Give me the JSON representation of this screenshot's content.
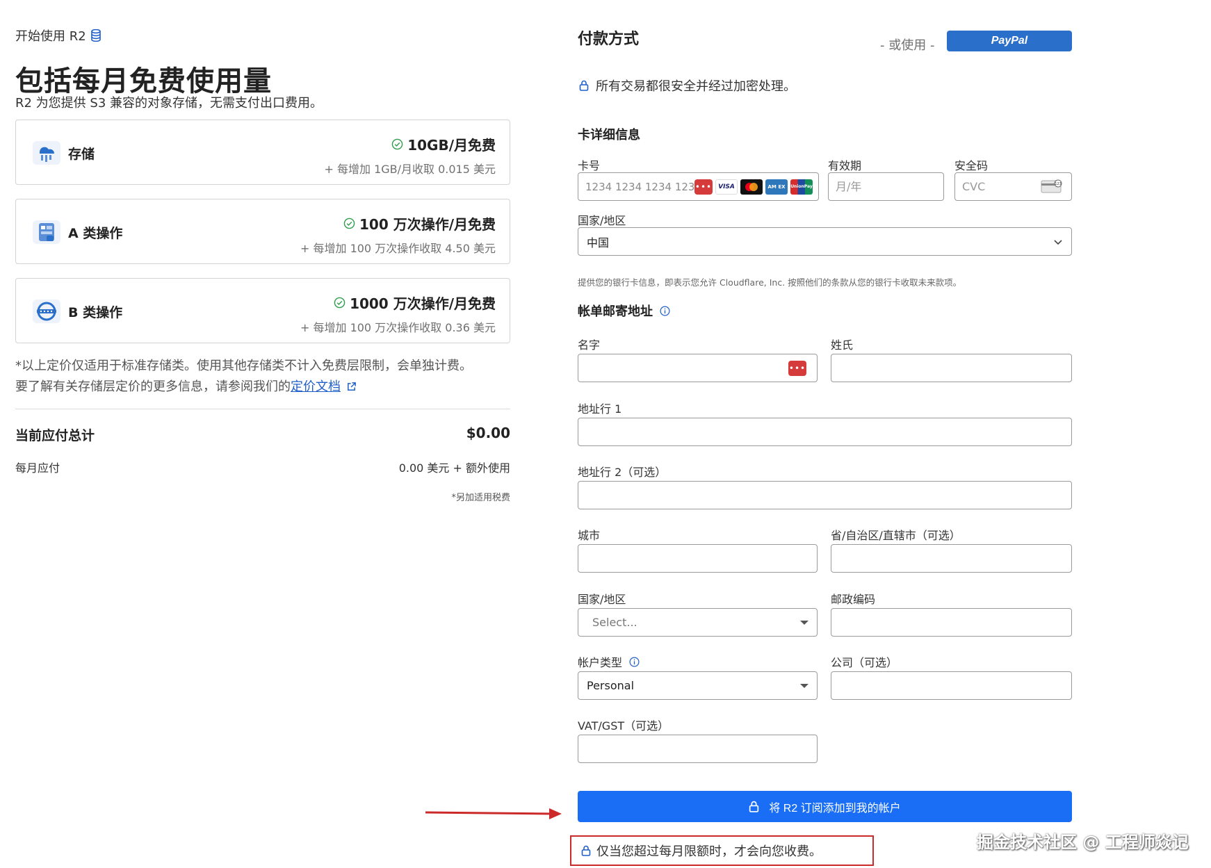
{
  "left": {
    "breadcrumb": "开始使用 R2",
    "title": "包括每月免费使用量",
    "subtitle": "R2 为您提供 S3 兼容的对象存储，无需支付出口费用。",
    "cards": [
      {
        "name": "存储",
        "free": "10GB/月免费",
        "extra": "+ 每增加 1GB/月收取 0.015 美元"
      },
      {
        "name": "A 类操作",
        "free": "100 万次操作/月免费",
        "extra": "+ 每增加 100 万次操作收取 4.50 美元"
      },
      {
        "name": "B 类操作",
        "free": "1000 万次操作/月免费",
        "extra": "+ 每增加 100 万次操作收取 0.36 美元"
      }
    ],
    "note_line1": "*以上定价仅适用于标准存储类。使用其他存储类不计入免费层限制，会单独计费。",
    "note_line2_prefix": "要了解有关存储层定价的更多信息，请参阅我们的",
    "note_link": "定价文档",
    "total_label": "当前应付总计",
    "total_value": "$0.00",
    "monthly_label": "每月应付",
    "monthly_value": "0.00 美元 + 额外使用",
    "tax_note": "*另加适用税费"
  },
  "right": {
    "title": "付款方式",
    "or_use": "- 或使用 -",
    "paypal_label": "PayPal",
    "secure_text": "所有交易都很安全并经过加密处理。",
    "card_section": "卡详细信息",
    "card_number_label": "卡号",
    "card_number_placeholder": "1234 1234 1234 1234",
    "expiry_label": "有效期",
    "expiry_placeholder": "月/年",
    "cvc_label": "安全码",
    "cvc_placeholder": "CVC",
    "country_label": "国家/地区",
    "country_value": "中国",
    "disclaimer": "提供您的银行卡信息，即表示您允许 Cloudflare, Inc. 按照他们的条款从您的银行卡收取未来款项。",
    "billing_section": "帐单邮寄地址",
    "first_name_label": "名字",
    "last_name_label": "姓氏",
    "address1_label": "地址行 1",
    "address2_label": "地址行 2（可选）",
    "city_label": "城市",
    "province_label": "省/自治区/直辖市（可选）",
    "country2_label": "国家/地区",
    "country2_placeholder": "Select...",
    "postal_label": "邮政编码",
    "account_type_label": "帐户类型",
    "account_type_value": "Personal",
    "company_label": "公司（可选）",
    "vat_label": "VAT/GST（可选）",
    "submit_label": "将 R2 订阅添加到我的帐户",
    "bottom_note": "仅当您超过每月限额时，才会向您收费。"
  },
  "brands": {
    "visa": "VISA",
    "amex": "AM EX",
    "unionpay": "UnionPay",
    "keypass": "•••"
  },
  "watermark": "掘金技术社区 @ 工程师焱记",
  "colors": {
    "primary": "#1a6ef5",
    "paypal": "#2a6fc9",
    "highlight": "#cc2a2a",
    "link": "#1f5fc9",
    "success": "#2e9e4a"
  }
}
